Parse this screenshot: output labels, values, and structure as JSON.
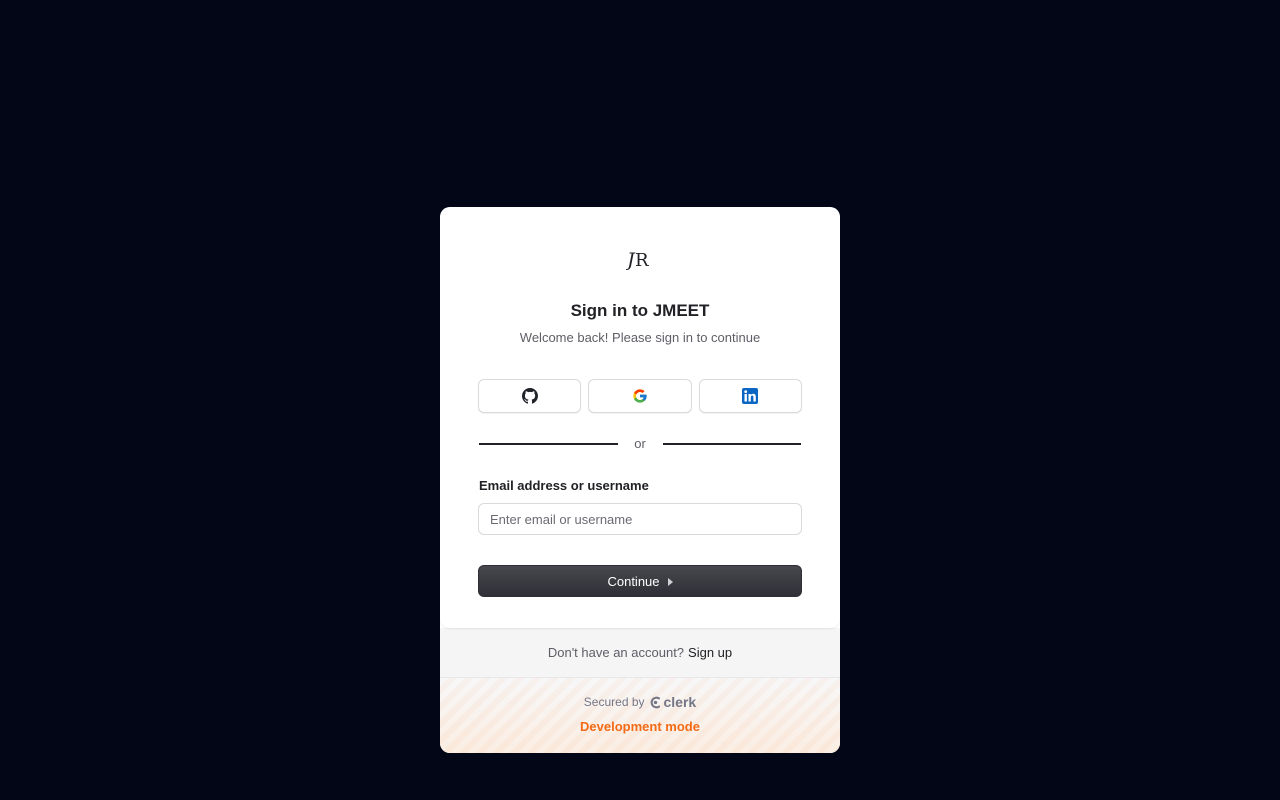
{
  "card": {
    "title": "Sign in to JMEET",
    "subtitle": "Welcome back! Please sign in to continue"
  },
  "social": {
    "github_icon": "github-icon",
    "google_icon": "google-icon",
    "linkedin_icon": "linkedin-icon"
  },
  "divider": {
    "text": "or"
  },
  "form": {
    "email_label": "Email address or username",
    "email_placeholder": "Enter email or username",
    "email_value": "",
    "continue_label": "Continue"
  },
  "footer": {
    "no_account_text": "Don't have an account?",
    "signup_link": "Sign up",
    "secured_by": "Secured by",
    "clerk_brand": "clerk",
    "dev_mode": "Development mode"
  },
  "colors": {
    "background": "#020617",
    "primary_button": "#2f3037",
    "dev_mode_orange": "#f36b16",
    "linkedin_blue": "#0a66c2"
  }
}
